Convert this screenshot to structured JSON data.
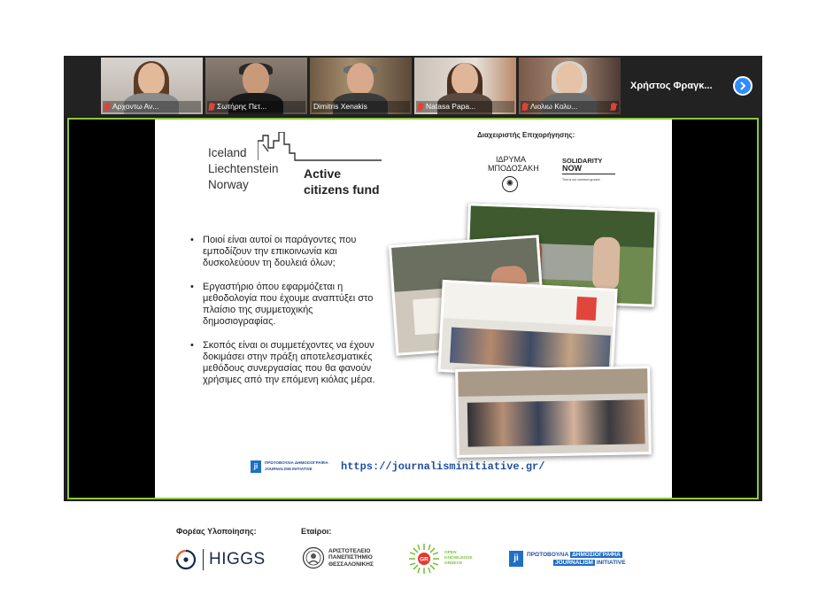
{
  "meeting": {
    "participants": [
      {
        "name": "Αρχοντω Αν...",
        "muted": true
      },
      {
        "name": "Σωτήρης Πετ...",
        "muted": true
      },
      {
        "name": "Dimitris Xenakis",
        "muted": false,
        "active": true
      },
      {
        "name": "Natasa Papa...",
        "muted": true
      },
      {
        "name": "Λιολιω Κολυ...",
        "muted": true
      }
    ],
    "overflow_participant": "Χρήστος Φραγκ...",
    "accent_color": "#8dc63f",
    "next_icon": "chevron-right-icon"
  },
  "slide": {
    "donor_lines": [
      "Iceland",
      "Liechtenstein",
      "Norway"
    ],
    "fund_lines": [
      "Active",
      "citizens fund"
    ],
    "manager_label": "Διαχειριστής Επιχορήγησης:",
    "bodossaki": "ΙΔΡΥΜΑ ΜΠΟΔΟΣΑΚΗ",
    "solidarity_lines": [
      "SOLIDARITY",
      "NOW"
    ],
    "solidarity_tagline": "This is our common ground",
    "bullets": [
      "Ποιοί είναι αυτοί οι παράγοντες που εμποδίζουν την επικοινωνία και δυσκολεύουν τη δουλειά όλων;",
      "Εργαστήριο όπου εφαρμόζεται η μεθοδολογία που έχουμε αναπτύξει στο πλαίσιο της συμμετοχικής δημοσιογραφίας.",
      "Σκοπός είναι οι συμμετέχοντες να έχουν δοκιμάσει στην πράξη αποτελεσματικές μεθόδους συνεργασίας που θα φανούν χρήσιμες από την επόμενη κιόλας μέρα."
    ],
    "url": "https://journalisminitiative.gr/",
    "ji_logo_text": [
      "ΠΡΩΤΟΒΟΥΛΙΑ ΔΗΜΟΣΙΟΓΡΑΦΙΑ",
      "JOURNALISM INITIATIVE"
    ]
  },
  "footer": {
    "implementer_label": "Φορέας Υλοποίησης:",
    "partners_label": "Εταίροι:",
    "higgs": "HIGGS",
    "auth_lines": [
      "ΑΡΙΣΤΟΤΕΛΕΙΟ",
      "ΠΑΝΕΠΙΣΤΗΜΙΟ",
      "ΘΕΣΣΑΛΟΝΙΚΗΣ"
    ],
    "okg_lines": [
      "OPEN",
      "KNOWLEDGE",
      "GREECE"
    ],
    "okg_badge": "GR",
    "ji_lines": [
      "ΠΡΩΤΟΒΟΥΛΙΑ",
      "ΔΗΜΟΣΙΟΓΡΑΦΙΑ",
      "JOURNALISM",
      "INITIATIVE"
    ],
    "ji_mark": "ji"
  }
}
